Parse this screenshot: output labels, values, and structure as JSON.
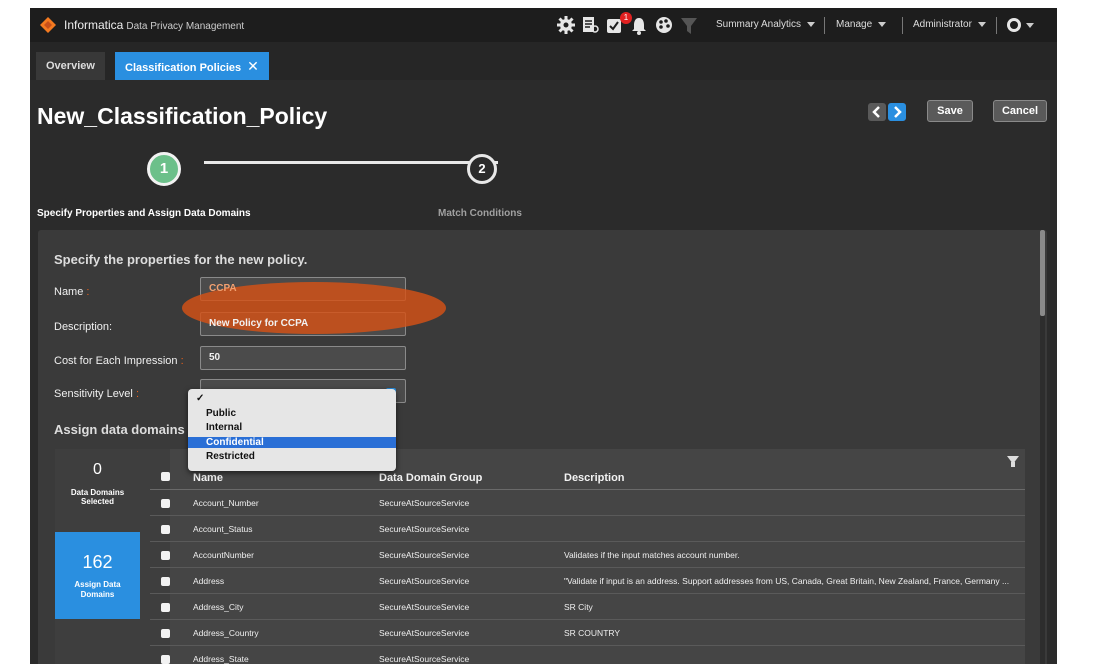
{
  "topbar": {
    "brand": "Informatica",
    "product": "Data Privacy Management",
    "notification_count": "1",
    "menus": [
      "Summary Analytics",
      "Manage",
      "Administrator"
    ]
  },
  "tabs": [
    {
      "label": "Overview",
      "active": false
    },
    {
      "label": "Classification Policies",
      "active": true,
      "close": "✕"
    }
  ],
  "page": {
    "title": "New_Classification_Policy",
    "save_label": "Save",
    "cancel_label": "Cancel",
    "prev_icon": "chevron-left",
    "next_icon": "chevron-right"
  },
  "steps": [
    {
      "number": "1",
      "label": "Specify Properties and Assign Data Domains",
      "active": true
    },
    {
      "number": "2",
      "label": "Match Conditions",
      "active": false
    }
  ],
  "form": {
    "intro": "Specify the properties for the new policy.",
    "name_label": "Name",
    "name_value": "CCPA",
    "description_label": "Description:",
    "description_value": "New Policy for CCPA",
    "cost_label": "Cost for Each Impression",
    "cost_value": "50",
    "sensitivity_label": "Sensitivity Level",
    "required_mark": ":",
    "assign_heading": "Assign data domains to"
  },
  "dropdown": {
    "check": "✓",
    "options": [
      "Public",
      "Internal",
      "Confidential",
      "Restricted"
    ],
    "highlighted": "Confidential"
  },
  "summary": {
    "selected_count": "0",
    "selected_label": "Data Domains Selected",
    "assign_count": "162",
    "assign_label": "Assign Data Domains"
  },
  "table": {
    "columns": [
      "Name",
      "Data Domain Group",
      "Description"
    ],
    "rows": [
      {
        "name": "Account_Number",
        "group": "SecureAtSourceService",
        "description": ""
      },
      {
        "name": "Account_Status",
        "group": "SecureAtSourceService",
        "description": ""
      },
      {
        "name": "AccountNumber",
        "group": "SecureAtSourceService",
        "description": "Validates if the input matches account number."
      },
      {
        "name": "Address",
        "group": "SecureAtSourceService",
        "description": "\"Validate if input is an address. Support addresses from US, Canada, Great Britain, New Zealand, France, Germany ..."
      },
      {
        "name": "Address_City",
        "group": "SecureAtSourceService",
        "description": "SR City"
      },
      {
        "name": "Address_Country",
        "group": "SecureAtSourceService",
        "description": "SR COUNTRY"
      },
      {
        "name": "Address_State",
        "group": "SecureAtSourceService",
        "description": ""
      }
    ]
  },
  "colors": {
    "accent": "#2a8fe0",
    "step_done": "#6cc08a",
    "required": "#e8601c",
    "highlight": "#d65216"
  }
}
